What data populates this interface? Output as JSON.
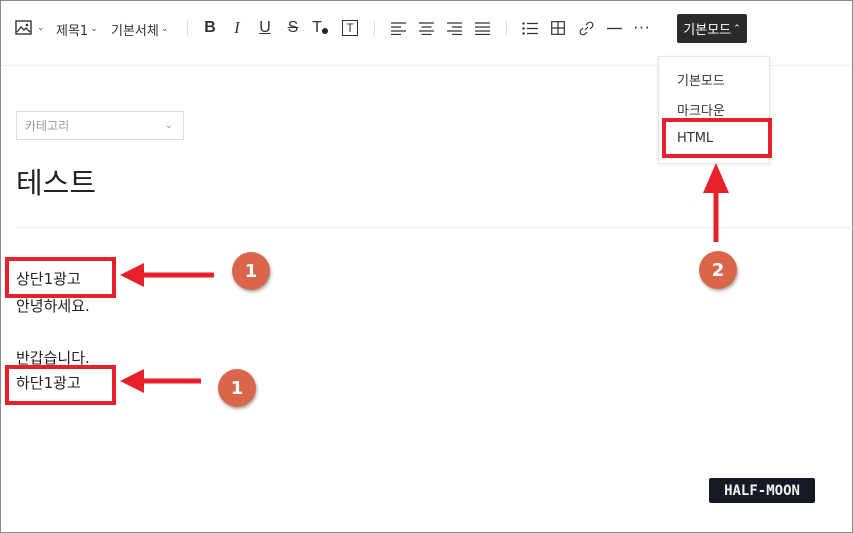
{
  "toolbar": {
    "image_icon": "image-icon",
    "heading_label": "제목1",
    "font_label": "기본서체",
    "bold_label": "B",
    "italic_label": "I",
    "underline_label": "U",
    "strike_label": "S",
    "text_color_label": "T",
    "text_bg_label": "T",
    "more_label": "···",
    "mode_label": "기본모드"
  },
  "mode_menu": {
    "items": [
      "기본모드",
      "마크다운",
      "HTML"
    ]
  },
  "editor": {
    "category_placeholder": "카테고리",
    "title": "테스트",
    "lines": [
      "상단1광고",
      "안녕하세요.",
      "반갑습니다.",
      "하단1광고"
    ]
  },
  "annotations": {
    "badge_1": "1",
    "badge_2": "2",
    "highlight_color": "#e8202a",
    "badge_color": "#d9654a"
  },
  "watermark": "HALF-MOON"
}
